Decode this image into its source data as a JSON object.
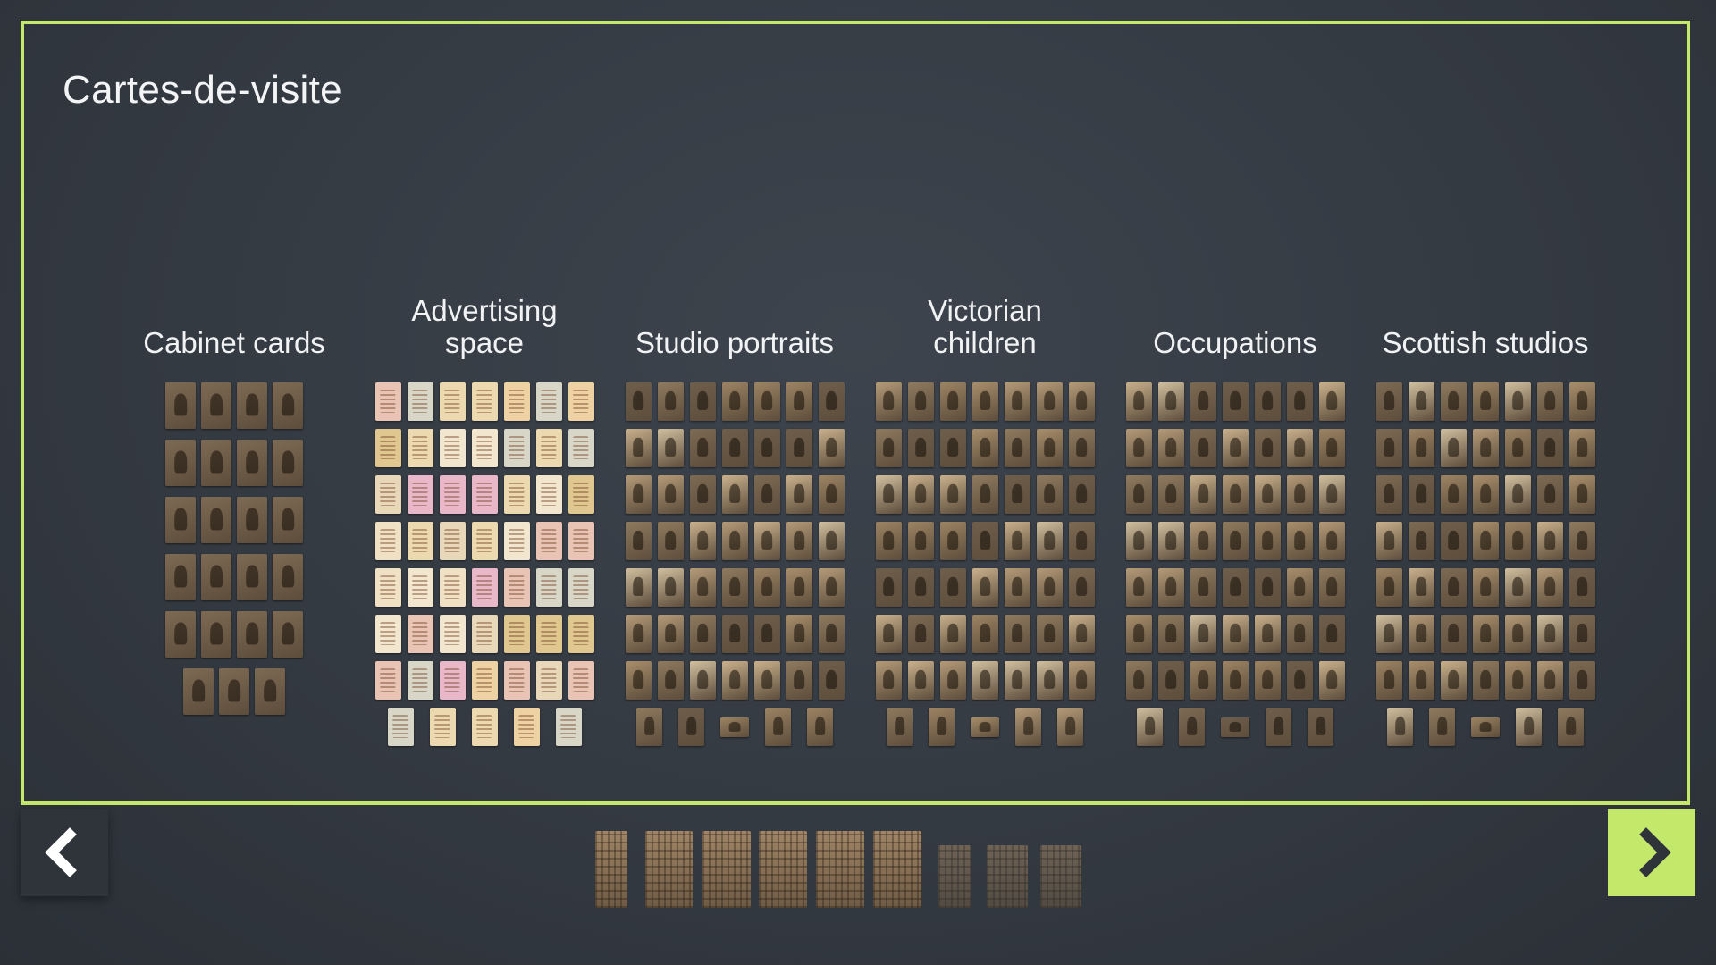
{
  "slide": {
    "title": "Cartes-de-visite"
  },
  "colors": {
    "accent": "#c3e86a",
    "background": "#343a42",
    "text": "#f1f3f4"
  },
  "groups": [
    {
      "label": "Cabinet cards",
      "layout": [
        4,
        4,
        4,
        4,
        4,
        3
      ],
      "style": "sepia"
    },
    {
      "label": "Advertising\nspace",
      "layout": [
        7,
        7,
        7,
        7,
        7,
        7,
        7,
        5
      ],
      "style": "advertising"
    },
    {
      "label": "Studio portraits",
      "layout": [
        7,
        7,
        7,
        7,
        7,
        7,
        7,
        5
      ],
      "style": "portrait"
    },
    {
      "label": "Victorian\nchildren",
      "layout": [
        7,
        7,
        7,
        7,
        7,
        7,
        7,
        5
      ],
      "style": "portrait"
    },
    {
      "label": "Occupations",
      "layout": [
        7,
        7,
        7,
        7,
        7,
        7,
        7,
        5
      ],
      "style": "portrait"
    },
    {
      "label": "Scottish studios",
      "layout": [
        7,
        7,
        7,
        7,
        7,
        7,
        7,
        5
      ],
      "style": "portrait"
    }
  ],
  "navigation": {
    "prev_icon": "chevron-left-icon",
    "next_icon": "chevron-right-icon"
  },
  "thumbnail_strip": {
    "count": 9,
    "dimmed_from": 6
  }
}
